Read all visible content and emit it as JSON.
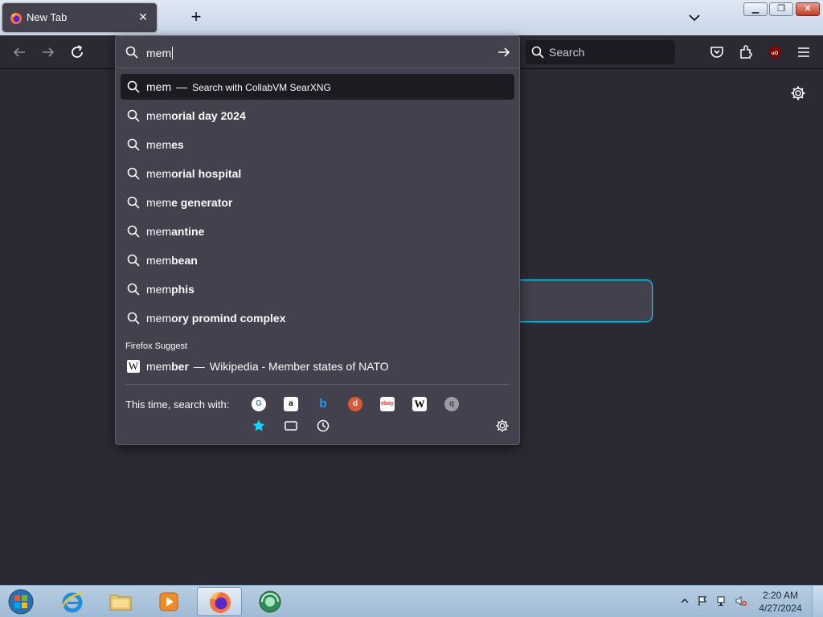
{
  "tab": {
    "title": "New Tab"
  },
  "toolbar": {
    "search_placeholder": "Search"
  },
  "urlbar": {
    "value": "mem"
  },
  "suggestions": [
    {
      "prefix": "mem",
      "bold": "",
      "action": "Search with CollabVM SearXNG",
      "selected": true
    },
    {
      "prefix": "mem",
      "bold": "orial day 2024"
    },
    {
      "prefix": "mem",
      "bold": "es"
    },
    {
      "prefix": "mem",
      "bold": "orial hospital"
    },
    {
      "prefix": "mem",
      "bold": "e generator"
    },
    {
      "prefix": "mem",
      "bold": "antine"
    },
    {
      "prefix": "mem",
      "bold": "bean"
    },
    {
      "prefix": "mem",
      "bold": "phis"
    },
    {
      "prefix": "mem",
      "bold": "ory promind complex"
    }
  ],
  "firefox_suggest": {
    "label": "Firefox Suggest",
    "prefix": "mem",
    "bold": "ber",
    "source": "Wikipedia - Member states of NATO"
  },
  "one_off": {
    "label": "This time, search with:",
    "engines": [
      "google-icon",
      "amazon-icon",
      "bing-icon",
      "duckduckgo-icon",
      "ebay-icon",
      "wikipedia-icon",
      "searxng-icon"
    ],
    "modes": [
      "bookmarks-icon",
      "tabs-icon",
      "history-icon"
    ]
  },
  "taskbar": {
    "time": "2:20 AM",
    "date": "4/27/2024"
  },
  "colors": {
    "accent": "#00ddff",
    "panel": "#42414d",
    "background": "#2b2a33"
  }
}
